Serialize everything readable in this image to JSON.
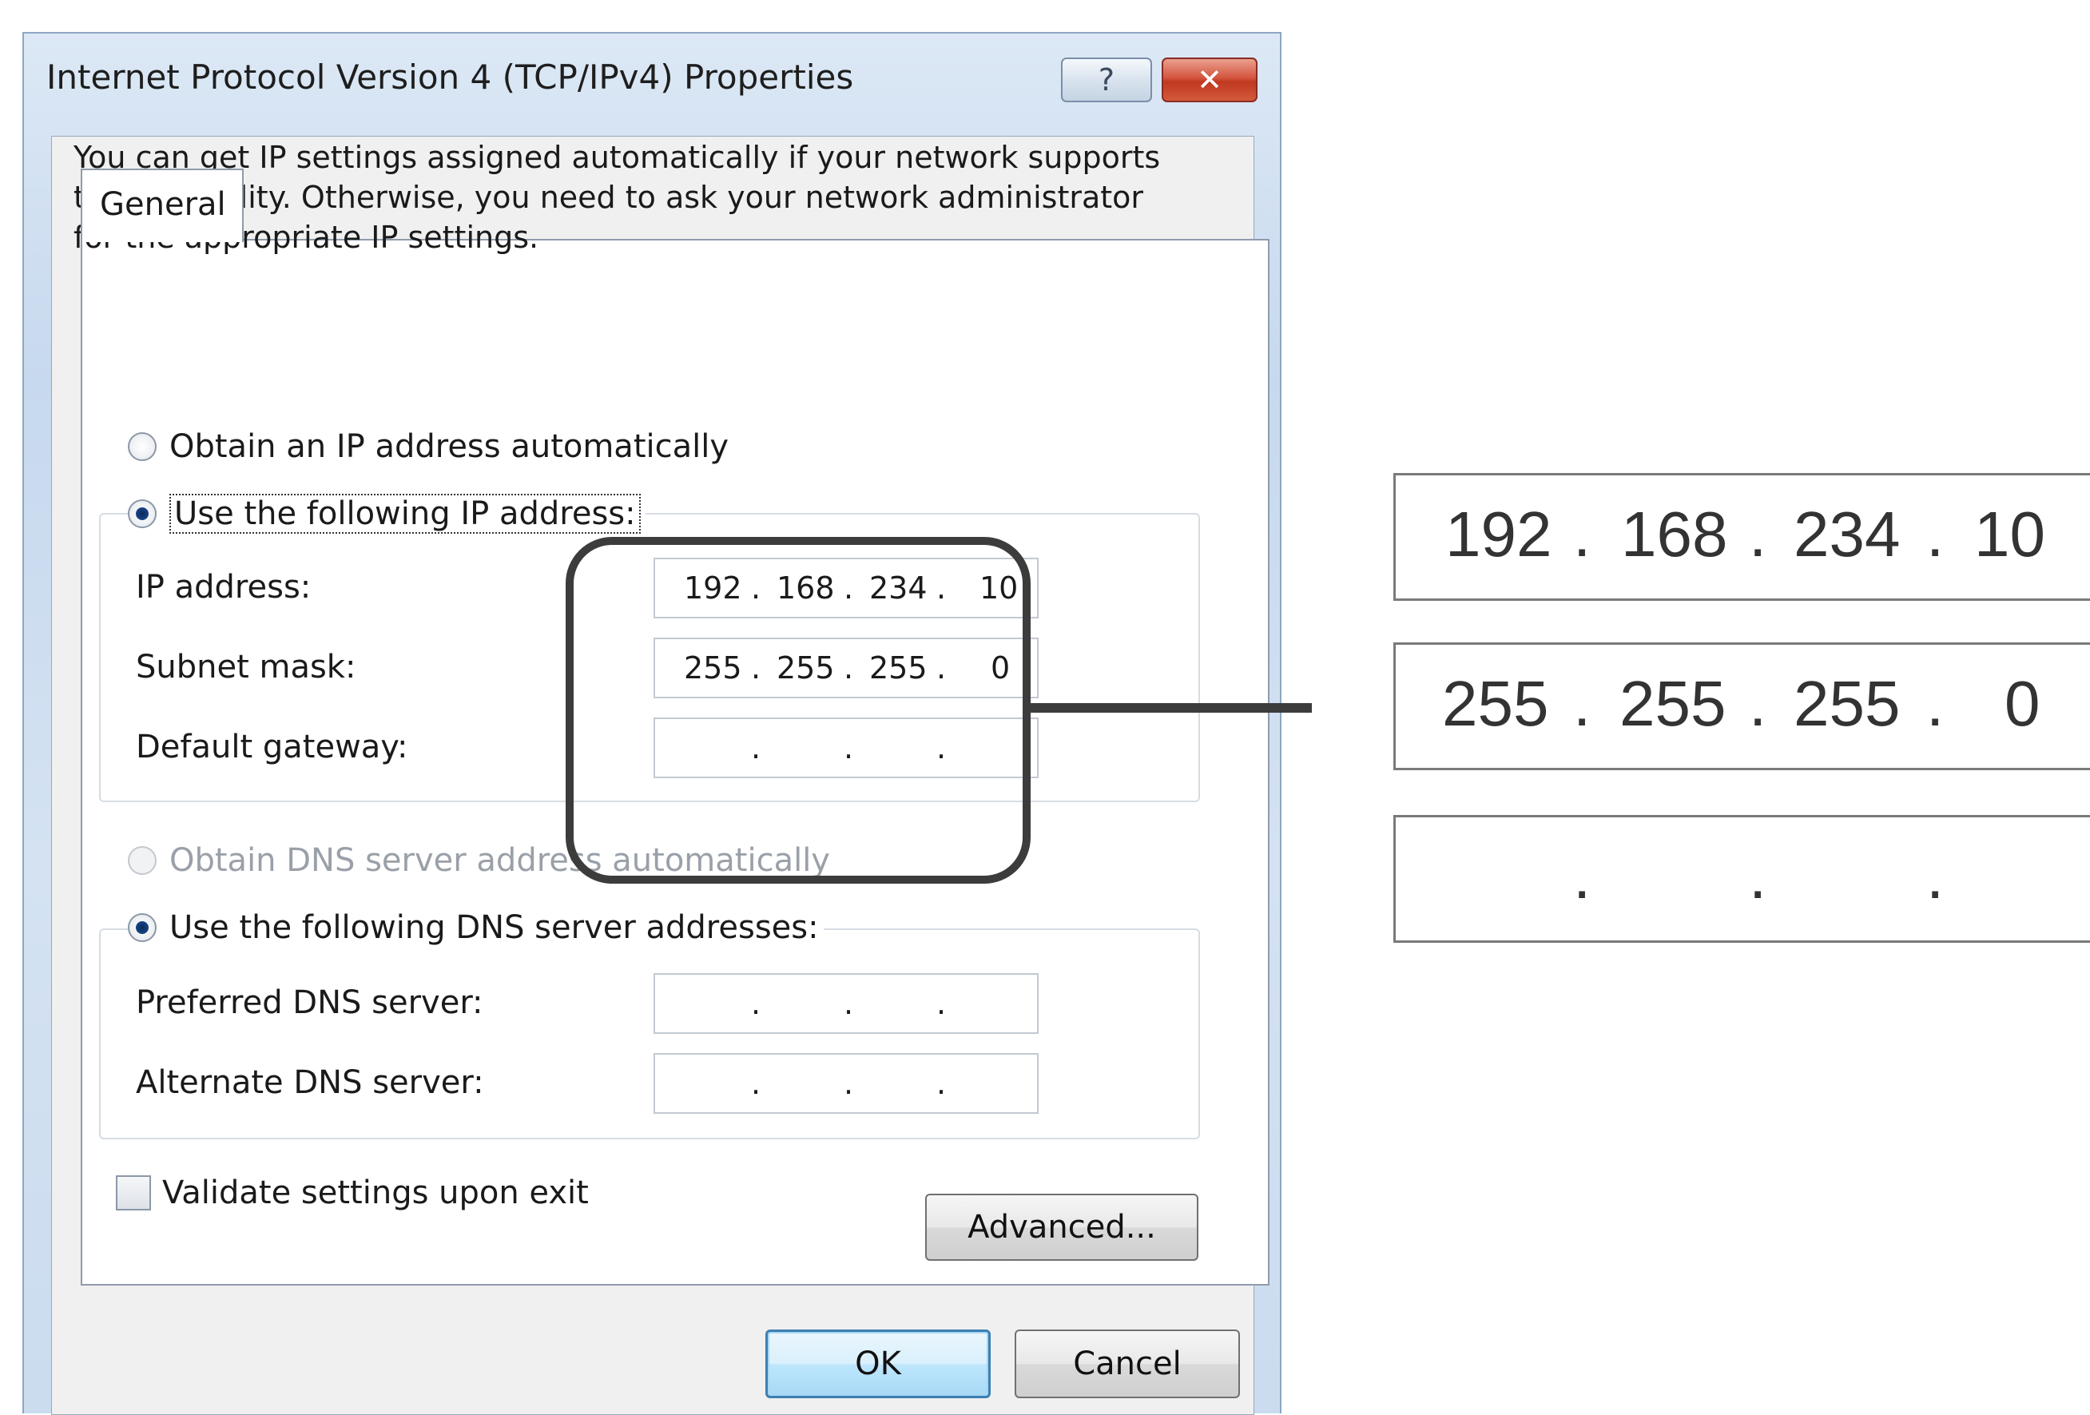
{
  "window": {
    "title": "Internet Protocol Version 4 (TCP/IPv4) Properties",
    "help_glyph": "?",
    "close_glyph": "✕"
  },
  "tabs": {
    "general": "General"
  },
  "description": [
    "You can get IP settings assigned automatically if your network supports",
    "this capability. Otherwise, you need to ask your network administrator",
    "for the appropriate IP settings."
  ],
  "ip_section": {
    "obtain_auto_label": "Obtain an IP address automatically",
    "use_following_label": "Use the following IP address:",
    "selected": "use_following",
    "ip_address_label": "IP address:",
    "subnet_mask_label": "Subnet mask:",
    "default_gateway_label": "Default gateway:",
    "ip_address": [
      "192",
      "168",
      "234",
      "10"
    ],
    "subnet_mask": [
      "255",
      "255",
      "255",
      "0"
    ],
    "default_gateway": [
      "",
      "",
      "",
      ""
    ]
  },
  "dns_section": {
    "obtain_auto_label": "Obtain DNS server address automatically",
    "use_following_label": "Use the following DNS server addresses:",
    "selected": "use_following",
    "preferred_label": "Preferred DNS server:",
    "alternate_label": "Alternate DNS server:",
    "preferred": [
      "",
      "",
      "",
      ""
    ],
    "alternate": [
      "",
      "",
      "",
      ""
    ]
  },
  "validate": {
    "label": "Validate settings upon exit",
    "checked": false
  },
  "buttons": {
    "advanced": "Advanced...",
    "ok": "OK",
    "cancel": "Cancel"
  },
  "zoom_callout": {
    "ip_address": [
      "192",
      "168",
      "234",
      "10"
    ],
    "subnet_mask": [
      "255",
      "255",
      "255",
      "0"
    ],
    "default_gateway": [
      "",
      "",
      "",
      ""
    ]
  },
  "dot": "."
}
